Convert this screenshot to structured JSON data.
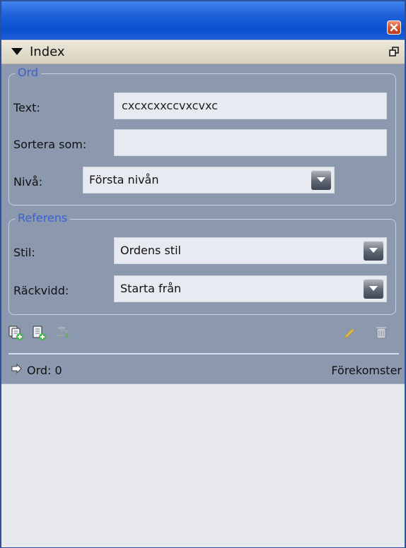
{
  "panel": {
    "title": "Index"
  },
  "ord": {
    "legend": "Ord",
    "text_label": "Text:",
    "text_value": "cxcxcxxccvxcvxc",
    "sort_label": "Sortera som:",
    "sort_value": "",
    "level_label": "Nivå:",
    "level_value": "Första nivån"
  },
  "referens": {
    "legend": "Referens",
    "style_label": "Stil:",
    "style_value": "Ordens stil",
    "range_label": "Räckvidd:",
    "range_value": "Starta från"
  },
  "list": {
    "left_label": "Ord: 0",
    "right_label": "Förekomster"
  },
  "colors": {
    "accent": "#3b62d4",
    "title_bar": "#1f62da",
    "panel_bg": "#8c98ad",
    "field_bg": "#e7eaf0"
  },
  "icons": {
    "close": "close-icon",
    "triangle": "collapse-icon",
    "undock": "undock-icon",
    "add_entry": "add-entry-icon",
    "add_reference": "add-reference-icon",
    "update": "update-icon",
    "edit": "pencil-icon",
    "delete": "trash-icon",
    "arrow": "arrow-icon"
  }
}
